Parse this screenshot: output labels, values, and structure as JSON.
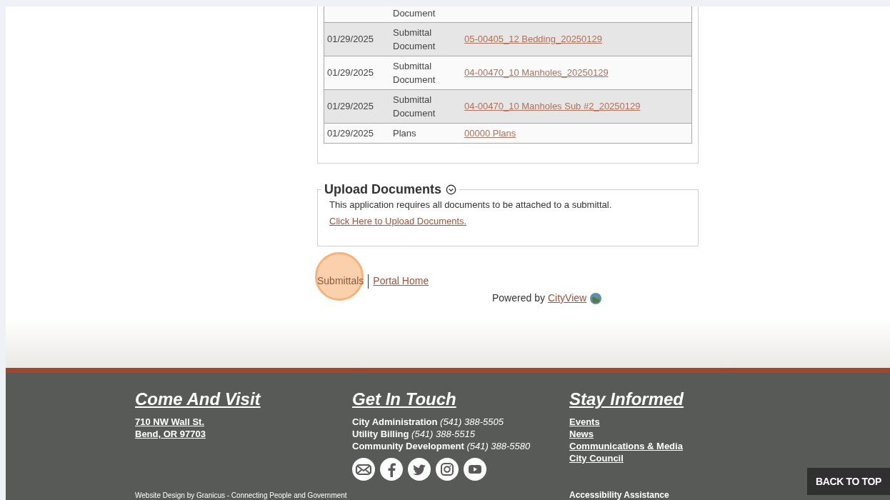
{
  "documents": {
    "rows": [
      {
        "type": "Document",
        "shaded": false
      },
      {
        "date": "01/29/2025",
        "type": "Submittal Document",
        "link": "05-00405_12 Bedding_20250129",
        "shaded": true
      },
      {
        "date": "01/29/2025",
        "type": "Submittal Document",
        "link": "04-00470_10 Manholes_20250129",
        "shaded": false
      },
      {
        "date": "01/29/2025",
        "type": "Submittal Document",
        "link": "04-00470_10 Manholes Sub #2_20250129",
        "shaded": true
      },
      {
        "date": "01/29/2025",
        "type": "Plans",
        "link": "00000 Plans",
        "shaded": false
      }
    ]
  },
  "upload": {
    "title": "Upload Documents",
    "text": "This application requires all documents to be attached to a submittal.",
    "link": "Click Here to Upload Documents."
  },
  "nav_links": [
    {
      "label": "Submittals",
      "highlighted": true
    },
    {
      "label": "Portal Home",
      "highlighted": false
    }
  ],
  "powered_by": {
    "text": "Powered by",
    "link": "CityView"
  },
  "footer": {
    "visit": {
      "title": "Come And Visit",
      "lines": [
        "710 NW Wall St.",
        "Bend, OR 97703"
      ]
    },
    "contact": {
      "title": "Get In Touch",
      "lines": [
        {
          "label": "City Administration",
          "phone": "(541) 388-5505"
        },
        {
          "label": "Utility Billing",
          "phone": "(541) 388-5515"
        },
        {
          "label": "Community Development",
          "phone": "(541) 388-5580"
        }
      ],
      "social": [
        {
          "kind": "email"
        },
        {
          "kind": "facebook"
        },
        {
          "kind": "twitter"
        },
        {
          "kind": "instagram"
        },
        {
          "kind": "youtube"
        }
      ]
    },
    "informed": {
      "title": "Stay Informed",
      "links": [
        "Events",
        "News",
        "Communications & Media",
        "City Council"
      ]
    },
    "credit": "Website Design by Granicus - Connecting People and Government",
    "accessibility": "Accessibility Assistance",
    "back_to_top": "BACK TO TOP"
  }
}
